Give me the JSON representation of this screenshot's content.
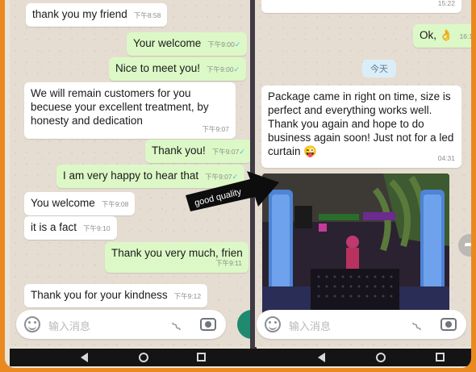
{
  "left_chat": {
    "messages": [
      {
        "dir": "in",
        "text": "thank you my friend",
        "time": "下午8:58"
      },
      {
        "dir": "out",
        "text": "Your welcome",
        "time": "下午9:00"
      },
      {
        "dir": "out",
        "text": "Nice to meet you!",
        "time": "下午9:00"
      },
      {
        "dir": "in",
        "text": "We will remain customers for you becuese your excellent treatment, by honesty and dedication",
        "time": "下午9:07"
      },
      {
        "dir": "out",
        "text": "Thank you!",
        "time": "下午9:07"
      },
      {
        "dir": "out",
        "text": "I am very happy to hear that",
        "time": "下午9:07"
      },
      {
        "dir": "in",
        "text": "You welcome",
        "time": "下午9:08"
      },
      {
        "dir": "in",
        "text": "it is a fact",
        "time": "下午9:10"
      },
      {
        "dir": "out",
        "text": "Thank you very much, frien",
        "time": "下午9:11"
      },
      {
        "dir": "in",
        "text": "Thank you for your kindness",
        "time": "下午9:12"
      }
    ],
    "input_placeholder": "输入消息"
  },
  "right_chat": {
    "top_time": "15:22",
    "ok_message": {
      "text": "Ok, 👌",
      "time": "16:1"
    },
    "date_chip": "今天",
    "review": {
      "text": "Package came in right on time, size is perfect and everything works well. Thank you again and hope to do business again soon! Just not for a led curtain 😜",
      "time": "04:31"
    },
    "input_placeholder": "输入消息"
  },
  "annotation": {
    "text": "good quality"
  },
  "colors": {
    "frame": "#e9891f",
    "outgoing": "#dcf8c6",
    "incoming": "#ffffff",
    "accent": "#1f8a70",
    "ticks": "#4fb6ec"
  }
}
